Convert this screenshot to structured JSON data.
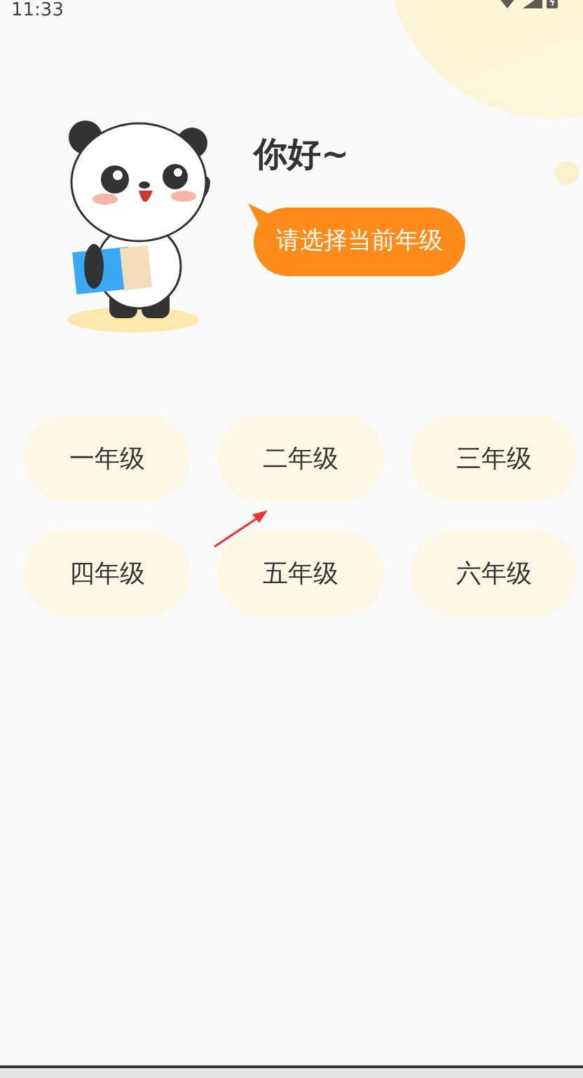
{
  "status_bar": {
    "time": "11:33"
  },
  "greeting": {
    "title": "你好~",
    "prompt": "请选择当前年级"
  },
  "grades": [
    {
      "label": "一年级",
      "selected": false
    },
    {
      "label": "二年级",
      "selected": false
    },
    {
      "label": "三年级",
      "selected": false
    },
    {
      "label": "四年级",
      "selected": false
    },
    {
      "label": "五年级",
      "selected": false
    },
    {
      "label": "六年级",
      "selected": false
    }
  ]
}
